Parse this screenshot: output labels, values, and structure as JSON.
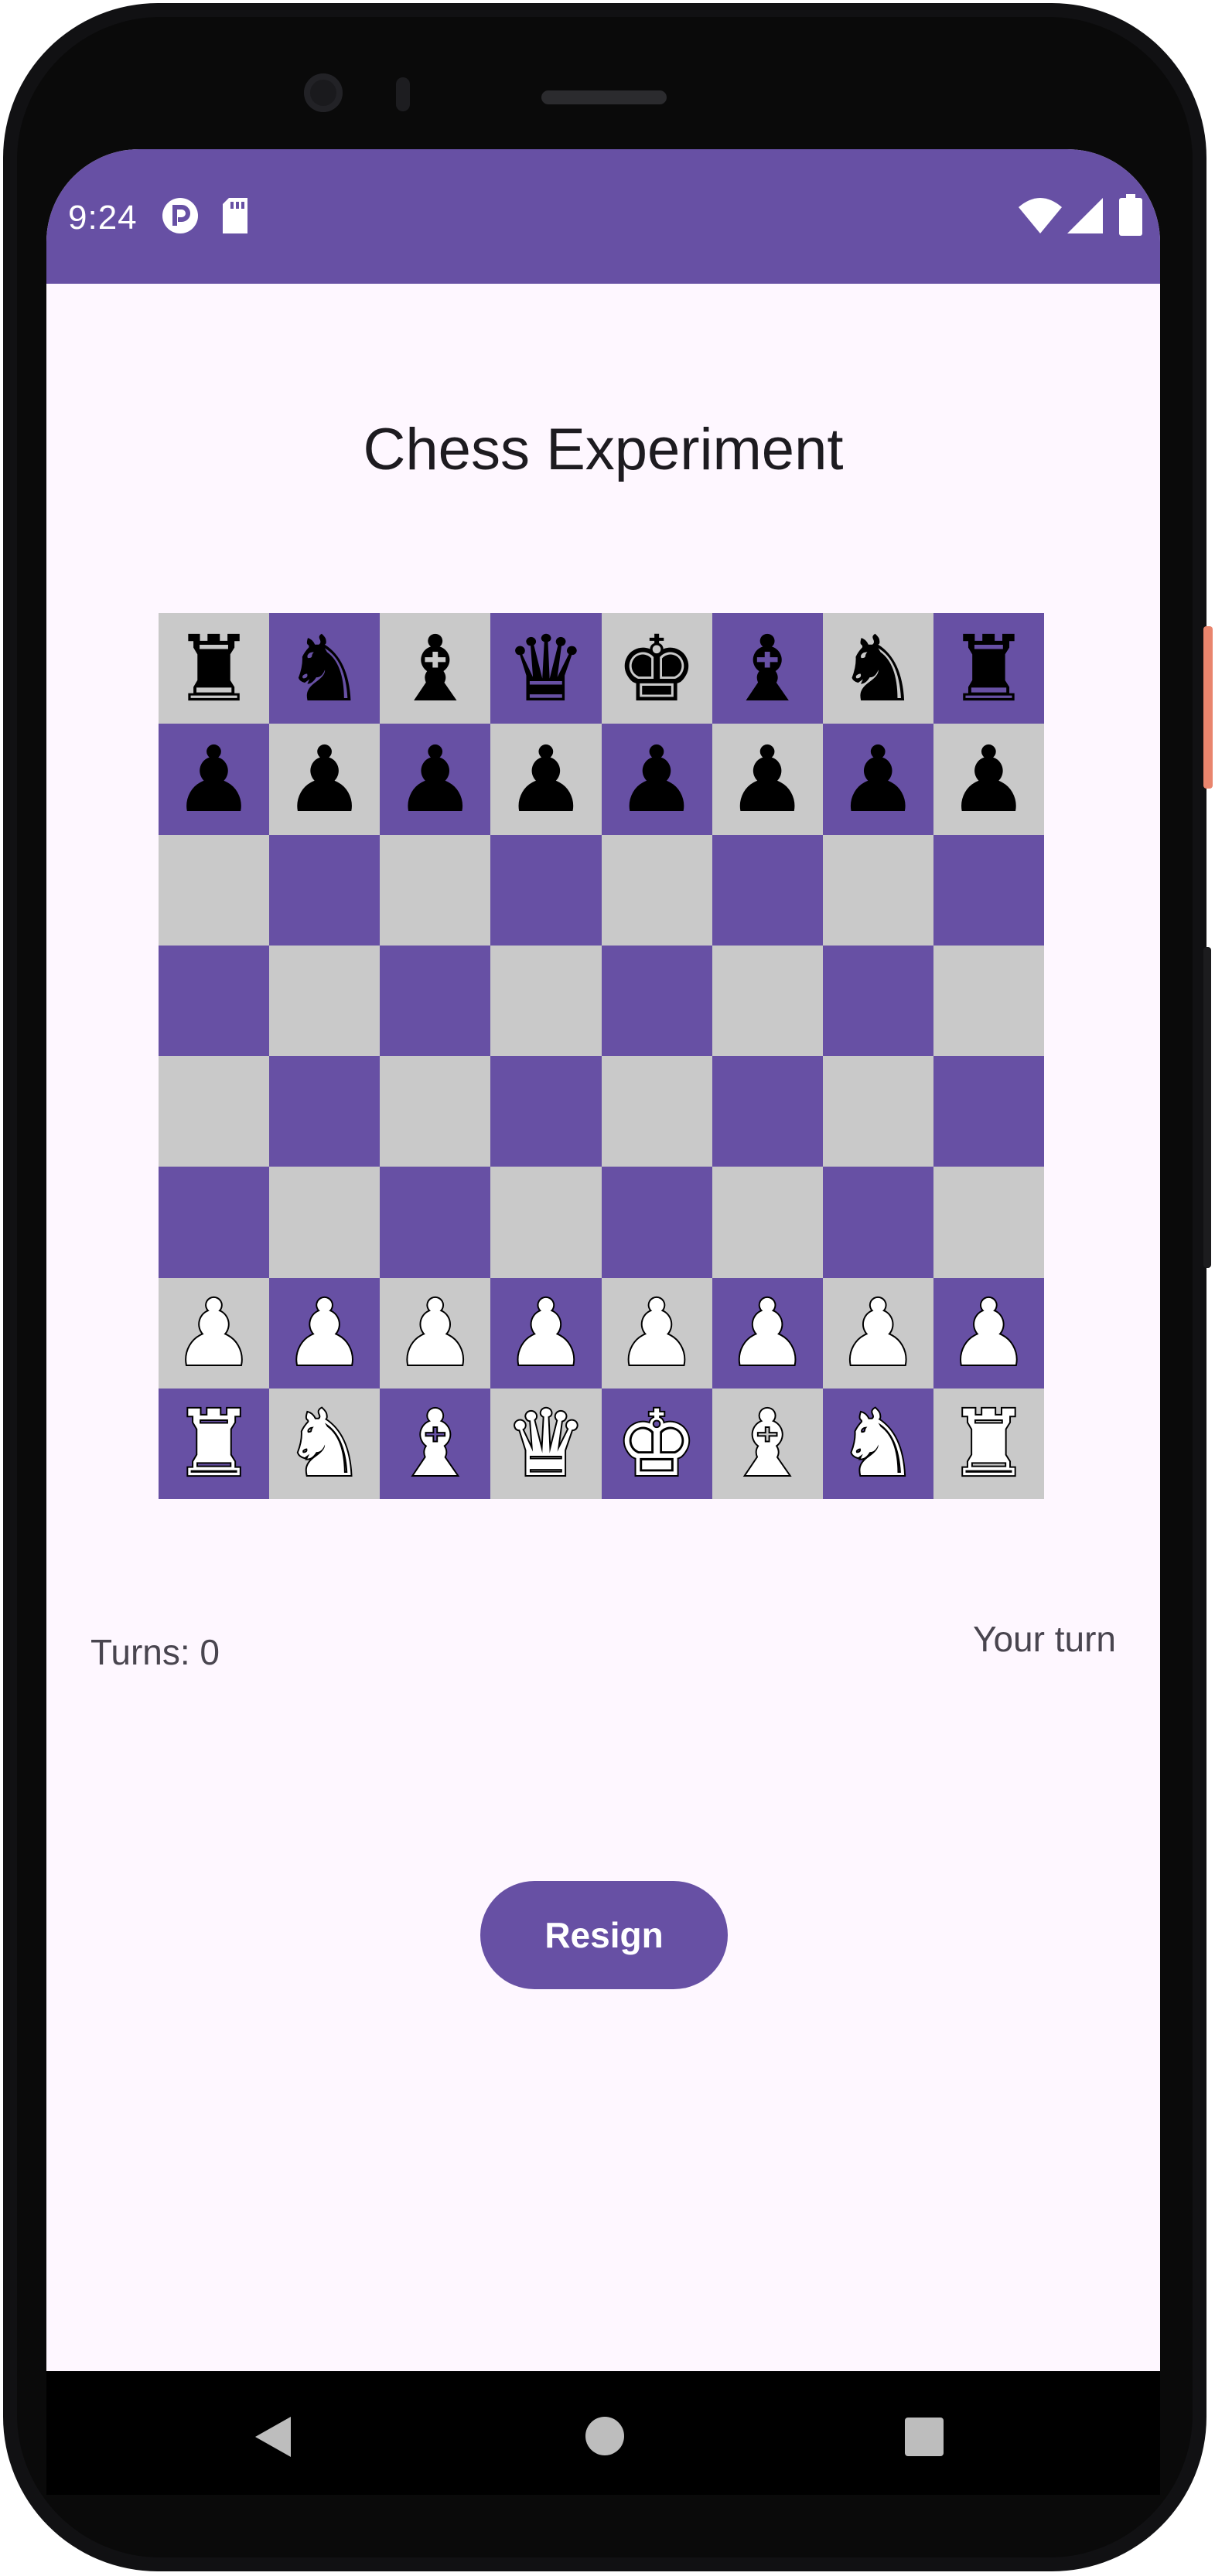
{
  "status_bar": {
    "time": "9:24",
    "left_icons": [
      "app-notification-icon",
      "sd-card-icon"
    ],
    "right_icons": [
      "wifi-icon",
      "cellular-signal-icon",
      "battery-icon"
    ]
  },
  "app": {
    "title": "Chess Experiment",
    "turns_label": "Turns: 0",
    "turn_status": "Your turn",
    "resign_label": "Resign"
  },
  "colors": {
    "primary": "#6750a4",
    "light_square": "#c9c9c9",
    "background": "#fef7ff"
  },
  "board": {
    "rows": [
      [
        "♜",
        "♞",
        "♝",
        "♛",
        "♚",
        "♝",
        "♞",
        "♜"
      ],
      [
        "♟",
        "♟",
        "♟",
        "♟",
        "♟",
        "♟",
        "♟",
        "♟"
      ],
      [
        "",
        "",
        "",
        "",
        "",
        "",
        "",
        ""
      ],
      [
        "",
        "",
        "",
        "",
        "",
        "",
        "",
        ""
      ],
      [
        "",
        "",
        "",
        "",
        "",
        "",
        "",
        ""
      ],
      [
        "",
        "",
        "",
        "",
        "",
        "",
        "",
        ""
      ],
      [
        "♟",
        "♟",
        "♟",
        "♟",
        "♟",
        "♟",
        "♟",
        "♟"
      ],
      [
        "♜",
        "♞",
        "♝",
        "♛",
        "♚",
        "♝",
        "♞",
        "♜"
      ]
    ],
    "colors": [
      [
        "black",
        "black",
        "black",
        "black",
        "black",
        "black",
        "black",
        "black"
      ],
      [
        "black",
        "black",
        "black",
        "black",
        "black",
        "black",
        "black",
        "black"
      ],
      [
        "",
        "",
        "",
        "",
        "",
        "",
        "",
        ""
      ],
      [
        "",
        "",
        "",
        "",
        "",
        "",
        "",
        ""
      ],
      [
        "",
        "",
        "",
        "",
        "",
        "",
        "",
        ""
      ],
      [
        "",
        "",
        "",
        "",
        "",
        "",
        "",
        ""
      ],
      [
        "white",
        "white",
        "white",
        "white",
        "white",
        "white",
        "white",
        "white"
      ],
      [
        "white",
        "white",
        "white",
        "white",
        "white",
        "white",
        "white",
        "white"
      ]
    ]
  },
  "nav_bar": {
    "icons": [
      "back-icon",
      "home-icon",
      "recents-icon"
    ]
  }
}
